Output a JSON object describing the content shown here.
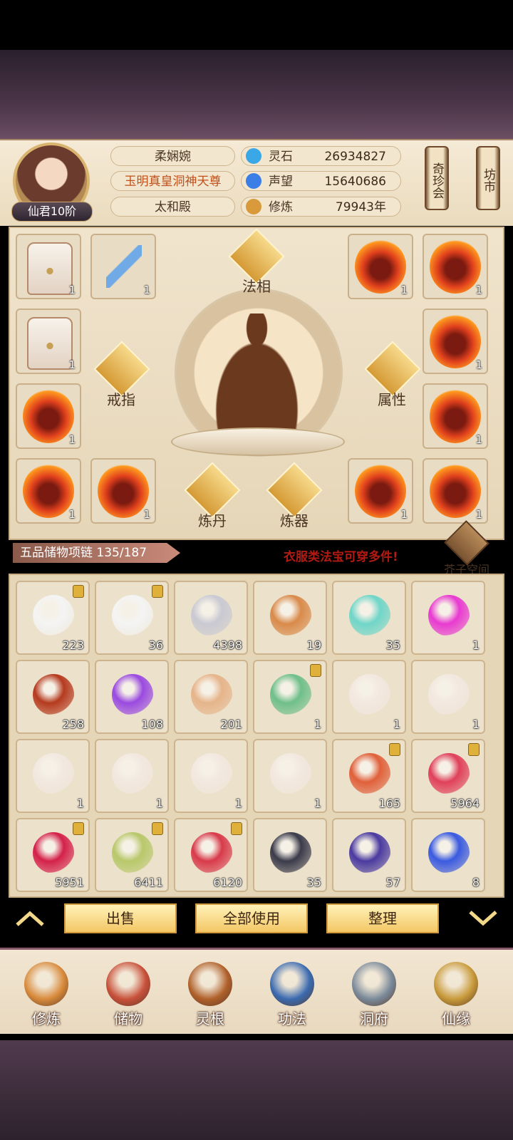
{
  "player": {
    "rank": "仙君10阶",
    "name": "柔娴婉",
    "title": "玉明真皇洞神天尊",
    "location": "太和殿"
  },
  "resources": [
    {
      "label": "灵石",
      "value": "26934827",
      "icon": "spirit-stone-icon",
      "color": "#3aa7e6"
    },
    {
      "label": "声望",
      "value": "15640686",
      "icon": "reputation-icon",
      "color": "#3a7ee6"
    },
    {
      "label": "修炼",
      "value": "79943年",
      "icon": "meditation-icon",
      "color": "#d89a3a"
    }
  ],
  "top_buttons": {
    "treasure": "奇珍会",
    "market": "坊市"
  },
  "equipment": {
    "center_labels": {
      "faxiang": "法相",
      "ring": "戒指",
      "attribute": "属性",
      "alchemy": "炼丹",
      "forge": "炼器"
    },
    "slots": [
      {
        "type": "white-robe",
        "count": "1"
      },
      {
        "type": "sword",
        "count": "1"
      },
      {
        "type": "fire-robe",
        "count": "1"
      },
      {
        "type": "fire-robe",
        "count": "1"
      },
      {
        "type": "white-robe",
        "count": "1"
      },
      {
        "type": "fire-robe",
        "count": "1"
      },
      {
        "type": "fire-robe",
        "count": "1"
      },
      {
        "type": "fire-robe",
        "count": "1"
      },
      {
        "type": "fire-robe",
        "count": "1"
      },
      {
        "type": "fire-robe",
        "count": "1"
      },
      {
        "type": "fire-robe",
        "count": "1"
      },
      {
        "type": "fire-robe",
        "count": "1"
      }
    ]
  },
  "storage": {
    "title": "五品储物项链 135/187",
    "hint": "衣服类法宝可穿多件!",
    "space_label": "芥子空间",
    "items": [
      {
        "count": "223",
        "locked": true,
        "color": "#f4f4f4"
      },
      {
        "count": "36",
        "locked": true,
        "color": "#f4f4f4"
      },
      {
        "count": "4398",
        "locked": false,
        "color": "#c9c9d2"
      },
      {
        "count": "19",
        "locked": false,
        "color": "#d98a4a"
      },
      {
        "count": "35",
        "locked": false,
        "color": "#6fd6c8"
      },
      {
        "count": "1",
        "locked": false,
        "color": "#e83ad0"
      },
      {
        "count": "258",
        "locked": false,
        "color": "#b53a1e"
      },
      {
        "count": "108",
        "locked": false,
        "color": "#9a4ae0"
      },
      {
        "count": "201",
        "locked": false,
        "color": "#e6b48a"
      },
      {
        "count": "1",
        "locked": true,
        "color": "#6fbf8a"
      },
      {
        "count": "1",
        "locked": false,
        "color": "#f2e8e0"
      },
      {
        "count": "1",
        "locked": false,
        "color": "#f2e8e0"
      },
      {
        "count": "1",
        "locked": false,
        "color": "#f2e8e0"
      },
      {
        "count": "1",
        "locked": false,
        "color": "#f2e8e0"
      },
      {
        "count": "1",
        "locked": false,
        "color": "#f2e8e0"
      },
      {
        "count": "1",
        "locked": false,
        "color": "#f2e8e0"
      },
      {
        "count": "165",
        "locked": true,
        "color": "#e0603a"
      },
      {
        "count": "5964",
        "locked": true,
        "color": "#e0405a"
      },
      {
        "count": "5951",
        "locked": true,
        "color": "#d4204a"
      },
      {
        "count": "6411",
        "locked": true,
        "color": "#b8c86a"
      },
      {
        "count": "6120",
        "locked": true,
        "color": "#d83a4a"
      },
      {
        "count": "35",
        "locked": false,
        "color": "#3a3a4a"
      },
      {
        "count": "57",
        "locked": false,
        "color": "#4a3aa0"
      },
      {
        "count": "8",
        "locked": false,
        "color": "#3a5ae0"
      }
    ]
  },
  "actions": {
    "sell": "出售",
    "use_all": "全部使用",
    "sort": "整理"
  },
  "nav": [
    {
      "label": "修炼",
      "icon": "cultivate-icon",
      "color": "#d88a3a"
    },
    {
      "label": "储物",
      "icon": "storage-bag-icon",
      "color": "#c8503a"
    },
    {
      "label": "灵根",
      "icon": "spirit-root-icon",
      "color": "#b0602a"
    },
    {
      "label": "功法",
      "icon": "technique-book-icon",
      "color": "#3a6ab0"
    },
    {
      "label": "洞府",
      "icon": "cave-dwelling-icon",
      "color": "#7a8a9a"
    },
    {
      "label": "仙缘",
      "icon": "immortal-fate-icon",
      "color": "#c89a3a"
    }
  ]
}
